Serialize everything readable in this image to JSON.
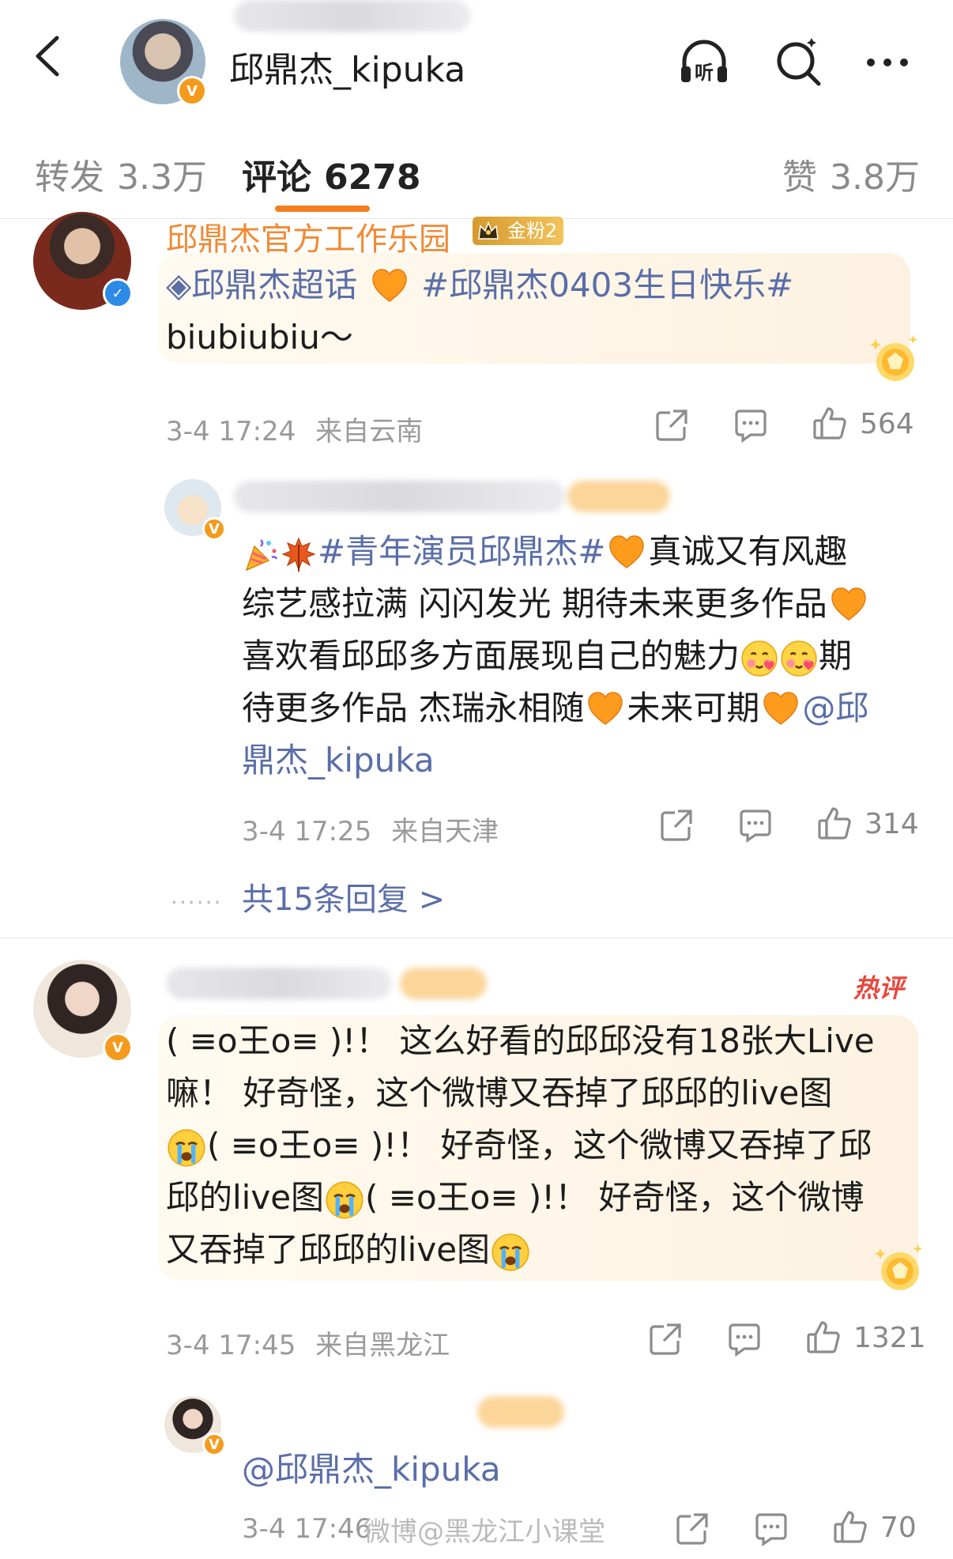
{
  "header": {
    "back_icon": "chevron-left-icon",
    "profile_name": "邱鼎杰_kipuka",
    "listen_label": "听"
  },
  "tabs": {
    "repost_label": "转发",
    "repost_count": "3.3万",
    "comments_label": "评论",
    "comments_count": "6278",
    "likes_label": "赞",
    "likes_count": "3.8万"
  },
  "comments": [
    {
      "user": "邱鼎杰官方工作乐园",
      "badge": "金粉2",
      "topic1": "◈邱鼎杰超话",
      "topic2": "#邱鼎杰0403生日快乐#",
      "text2": "biubiubiu～",
      "time": "3-4 17:24",
      "location": "来自云南",
      "likes": "564"
    },
    {
      "topic": "#青年演员邱鼎杰#",
      "t1": "真诚又有风趣",
      "t2": "综艺感拉满 闪闪发光 期待未来更多作品",
      "t3": "喜欢看邱邱多方面展现自己的魅力",
      "t3b": "期",
      "t4a": "待更多作品 杰瑞永相随",
      "t4b": "未来可期",
      "mention_a": "@邱",
      "mention_b": "鼎杰_kipuka",
      "time": "3-4 17:25",
      "location": "来自天津",
      "likes": "314",
      "replies": "共15条回复 >"
    },
    {
      "hot_label": "热评",
      "l1": "( ≡o王o≡ )!！ 这么好看的邱邱没有18张大Live",
      "l2": "嘛！ 好奇怪，这个微博又吞掉了邱邱的live图",
      "l3": "( ≡o王o≡ )!！ 好奇怪，这个微博又吞掉了邱",
      "l4a": "邱的live图",
      "l4b": "( ≡o王o≡ )!！ 好奇怪，这个微博",
      "l5": "又吞掉了邱邱的live图",
      "time": "3-4 17:45",
      "location": "来自黑龙江",
      "likes": "1321"
    },
    {
      "mention": "@邱鼎杰_kipuka",
      "time": "3-4 17:46",
      "likes": "70"
    }
  ],
  "watermark": "微博@黑龙江小课堂",
  "colors": {
    "accent": "#f47e1f",
    "link": "#5a6ea8",
    "hot": "#e8473c"
  }
}
